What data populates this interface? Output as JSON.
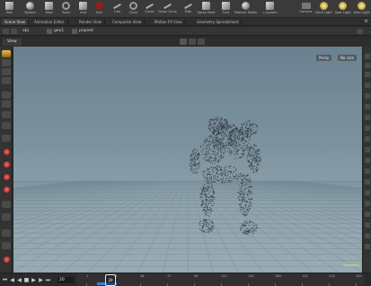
{
  "shelf": {
    "tools": [
      {
        "label": "Box",
        "icon": "box-icon"
      },
      {
        "label": "Sphere",
        "icon": "sphere-icon"
      },
      {
        "label": "Tube",
        "icon": "tube-icon"
      },
      {
        "label": "Torus",
        "icon": "torus-icon"
      },
      {
        "label": "Grid",
        "icon": "grid-icon"
      },
      {
        "label": "Null",
        "icon": "null-icon"
      },
      {
        "label": "Line",
        "icon": "line-icon"
      },
      {
        "label": "Circle",
        "icon": "circle-icon"
      },
      {
        "label": "Curve",
        "icon": "curve-icon"
      },
      {
        "label": "Draw Curve",
        "icon": "draw-curve-icon"
      },
      {
        "label": "Path",
        "icon": "path-icon"
      },
      {
        "label": "Spray Paint",
        "icon": "spray-paint-icon"
      },
      {
        "label": "Font",
        "icon": "font-icon"
      },
      {
        "label": "Platonic Solids",
        "icon": "platonic-solids-icon"
      },
      {
        "label": "L-System",
        "icon": "l-system-icon"
      },
      {
        "label": "Camera",
        "icon": "camera-icon"
      },
      {
        "label": "Point Light",
        "icon": "point-light-icon"
      },
      {
        "label": "Spot Light",
        "icon": "spot-light-icon"
      },
      {
        "label": "Area Light",
        "icon": "area-light-icon"
      }
    ]
  },
  "tabs": [
    {
      "label": "Scene View"
    },
    {
      "label": "Animation Editor"
    },
    {
      "label": "Render View"
    },
    {
      "label": "Composite View"
    },
    {
      "label": "Motion FX View"
    },
    {
      "label": "Geometry Spreadsheet"
    }
  ],
  "path": {
    "obj": "obj",
    "geo": "geo1",
    "node": "popnet"
  },
  "viewport": {
    "tab_label": "View",
    "camera_btn": "Persp",
    "cam_btn": "No cam",
    "info": "Geometry"
  },
  "timeline": {
    "frame": "20",
    "ticks": [
      "1",
      "24",
      "48",
      "72",
      "96",
      "120",
      "144",
      "168",
      "192",
      "216",
      "240"
    ],
    "playhead_frame": "20"
  },
  "colors": {
    "viewport_top": "#6a8190",
    "viewport_bottom": "#9aabb3",
    "particles": "#2a2f33",
    "accent_blue": "#3a7be0"
  }
}
